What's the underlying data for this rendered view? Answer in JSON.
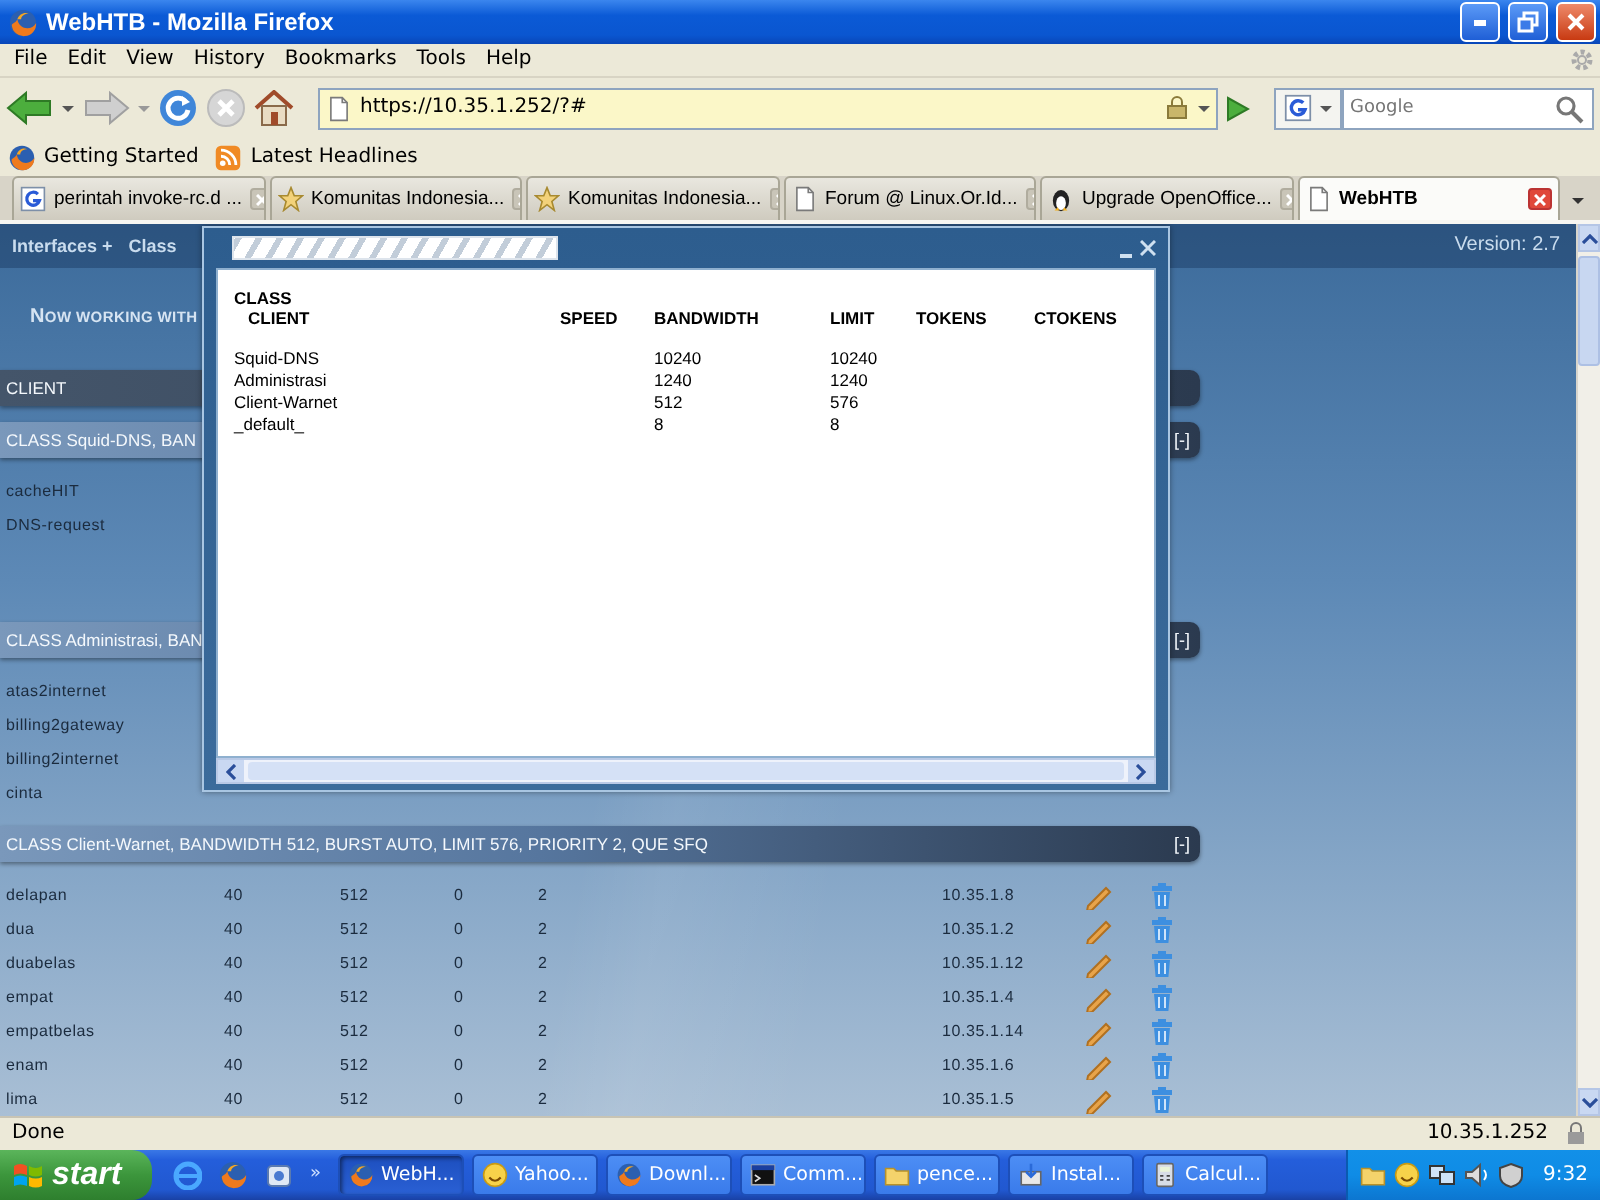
{
  "window": {
    "title": "WebHTB - Mozilla Firefox"
  },
  "menu": [
    "File",
    "Edit",
    "View",
    "History",
    "Bookmarks",
    "Tools",
    "Help"
  ],
  "address_bar": {
    "url": "https://10.35.1.252/?#"
  },
  "search": {
    "placeholder": "Google"
  },
  "bookmarks": [
    {
      "label": "Getting Started",
      "kind": "firefox"
    },
    {
      "label": "Latest Headlines",
      "kind": "feed"
    }
  ],
  "tabs": [
    {
      "label": "perintah invoke-rc.d ...",
      "kind": "google",
      "selected": false
    },
    {
      "label": "Komunitas Indonesia...",
      "kind": "star",
      "selected": false
    },
    {
      "label": "Komunitas Indonesia...",
      "kind": "star",
      "selected": false
    },
    {
      "label": "Forum @ Linux.Or.Id...",
      "kind": "page",
      "selected": false
    },
    {
      "label": "Upgrade OpenOffice...",
      "kind": "penguin",
      "selected": false
    },
    {
      "label": "WebHTB",
      "kind": "page",
      "selected": true
    }
  ],
  "page": {
    "nav": [
      "Interfaces +",
      "Class"
    ],
    "version": "Version: 2.7",
    "heading": "NOW WORKING WITH",
    "client_bar": "CLIENT",
    "sections": [
      {
        "title": "CLASS Squid-DNS, BAN",
        "toggle": "[-]",
        "rows": [
          {
            "name": "cacheHIT"
          },
          {
            "name": "DNS-request"
          }
        ]
      },
      {
        "title": "CLASS Administrasi, BAN",
        "toggle": "[-]",
        "rows": [
          {
            "name": "atas2internet"
          },
          {
            "name": "billing2gateway"
          },
          {
            "name": "billing2internet"
          },
          {
            "name": "cinta"
          }
        ]
      },
      {
        "title": "CLASS Client-Warnet, BANDWIDTH 512, BURST AUTO, LIMIT 576, PRIORITY 2, QUE SFQ",
        "toggle": "[-]",
        "rows": [
          {
            "name": "delapan",
            "cells": [
              "40",
              "512",
              "0",
              "2"
            ],
            "ip": "10.35.1.8"
          },
          {
            "name": "dua",
            "cells": [
              "40",
              "512",
              "0",
              "2"
            ],
            "ip": "10.35.1.2"
          },
          {
            "name": "duabelas",
            "cells": [
              "40",
              "512",
              "0",
              "2"
            ],
            "ip": "10.35.1.12"
          },
          {
            "name": "empat",
            "cells": [
              "40",
              "512",
              "0",
              "2"
            ],
            "ip": "10.35.1.4"
          },
          {
            "name": "empatbelas",
            "cells": [
              "40",
              "512",
              "0",
              "2"
            ],
            "ip": "10.35.1.14"
          },
          {
            "name": "enam",
            "cells": [
              "40",
              "512",
              "0",
              "2"
            ],
            "ip": "10.35.1.6"
          },
          {
            "name": "lima",
            "cells": [
              "40",
              "512",
              "0",
              "2"
            ],
            "ip": "10.35.1.5"
          }
        ]
      }
    ]
  },
  "popup": {
    "header": "CLASS",
    "columns": [
      "CLIENT",
      "SPEED",
      "BANDWIDTH",
      "LIMIT",
      "TOKENS",
      "CTOKENS"
    ],
    "rows": [
      {
        "client": "Squid-DNS",
        "bandwidth": "10240",
        "limit": "10240"
      },
      {
        "client": "Administrasi",
        "bandwidth": "1240",
        "limit": "1240"
      },
      {
        "client": "Client-Warnet",
        "bandwidth": "512",
        "limit": "576"
      },
      {
        "client": "_default_",
        "bandwidth": "8",
        "limit": "8"
      }
    ]
  },
  "status_bar": {
    "text": "Done",
    "host": "10.35.1.252"
  },
  "taskbar": {
    "start": "start",
    "more": "»",
    "tasks": [
      {
        "label": "WebH...",
        "kind": "firefox",
        "selected": true
      },
      {
        "label": "Yahoo...",
        "kind": "smiley",
        "selected": false
      },
      {
        "label": "Downl...",
        "kind": "firefox",
        "selected": false
      },
      {
        "label": "Comm...",
        "kind": "console",
        "selected": false
      },
      {
        "label": "pence...",
        "kind": "folder",
        "selected": false
      },
      {
        "label": "Instal...",
        "kind": "installer",
        "selected": false
      },
      {
        "label": "Calcul...",
        "kind": "calculator",
        "selected": false
      }
    ],
    "clock": "9:32"
  }
}
